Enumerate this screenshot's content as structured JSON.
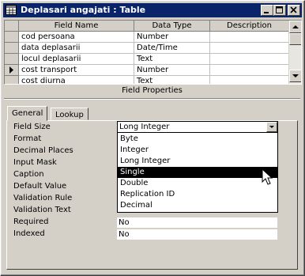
{
  "window": {
    "title": "Deplasari angajati : Table",
    "controls": [
      "minimize-icon",
      "maximize-icon",
      "close-icon"
    ]
  },
  "grid": {
    "columns": [
      "Field Name",
      "Data Type",
      "Description"
    ],
    "rows": [
      {
        "name": "cod persoana",
        "type": "Number",
        "desc": ""
      },
      {
        "name": "data deplasarii",
        "type": "Date/Time",
        "desc": ""
      },
      {
        "name": "locul deplasarii",
        "type": "Text",
        "desc": ""
      },
      {
        "name": "cost transport",
        "type": "Number",
        "desc": "",
        "current": true
      },
      {
        "name": "cost diurna",
        "type": "Text",
        "desc": ""
      }
    ]
  },
  "field_properties": {
    "title": "Field Properties",
    "tabs": [
      "General",
      "Lookup"
    ],
    "active_tab": "General",
    "properties": [
      {
        "label": "Field Size",
        "value": "Long Integer"
      },
      {
        "label": "Format",
        "value": ""
      },
      {
        "label": "Decimal Places",
        "value": ""
      },
      {
        "label": "Input Mask",
        "value": ""
      },
      {
        "label": "Caption",
        "value": ""
      },
      {
        "label": "Default Value",
        "value": ""
      },
      {
        "label": "Validation Rule",
        "value": ""
      },
      {
        "label": "Validation Text",
        "value": ""
      },
      {
        "label": "Required",
        "value": "No"
      },
      {
        "label": "Indexed",
        "value": "No"
      }
    ],
    "field_size_options": [
      "Byte",
      "Integer",
      "Long Integer",
      "Single",
      "Double",
      "Replication ID",
      "Decimal"
    ],
    "highlighted_option": "Single"
  },
  "colors": {
    "title_bar": "#0a246a",
    "face": "#d4d0c8",
    "selection": "#000000"
  }
}
